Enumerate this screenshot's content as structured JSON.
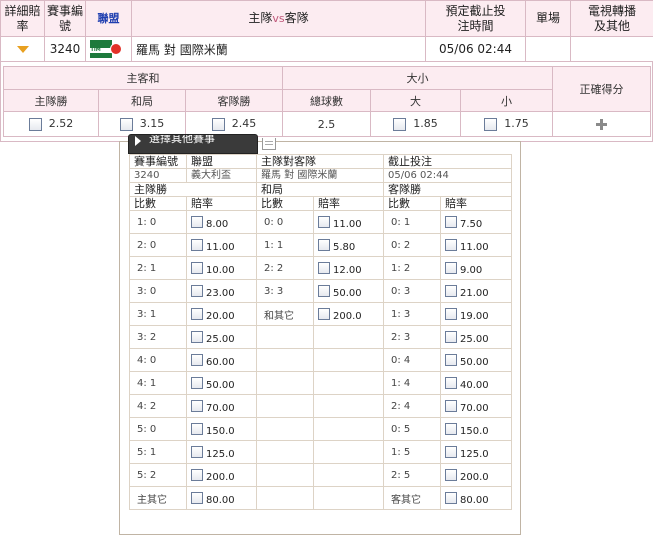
{
  "header": {
    "detail_odds": "詳細賠率",
    "match_no": "賽事編號",
    "league": "聯盟",
    "teams_prefix": "主隊",
    "teams_vs": "vs",
    "teams_suffix": "客隊",
    "close_time": "預定截止投注時間",
    "single": "單場",
    "tv": "電視轉播及其他"
  },
  "match": {
    "number": "3240",
    "league_icon": "tim-cup-logo",
    "home": "羅馬",
    "vs": "對",
    "away": "國際米蘭",
    "time": "05/06 02:44",
    "single": "",
    "tv": ""
  },
  "odds": {
    "group_hda": "主客和",
    "group_ou": "大小",
    "group_cs": "正確得分",
    "col_home": "主隊勝",
    "col_draw": "和局",
    "col_away": "客隊勝",
    "col_total": "總球數",
    "col_over": "大",
    "col_under": "小",
    "val_home": "2.52",
    "val_draw": "3.15",
    "val_away": "2.45",
    "val_total": "2.5",
    "val_over": "1.85",
    "val_under": "1.75",
    "expand_icon": "plus-icon"
  },
  "popup": {
    "tab_label": "選擇其他賽事",
    "head": {
      "match_no": "賽事編號",
      "league": "聯盟",
      "teams": "主隊對客隊",
      "close": "截止投注",
      "number": "3240",
      "league_name": "義大利盃",
      "teams_value": "羅馬 對 國際米蘭",
      "time": "05/06 02:44"
    },
    "sections": {
      "home": "主隊勝",
      "draw": "和局",
      "away": "客隊勝"
    },
    "col_score": "比數",
    "col_odds": "賠率",
    "home_scores": [
      {
        "s": "1: 0",
        "o": "8.00"
      },
      {
        "s": "2: 0",
        "o": "11.00"
      },
      {
        "s": "2: 1",
        "o": "10.00"
      },
      {
        "s": "3: 0",
        "o": "23.00"
      },
      {
        "s": "3: 1",
        "o": "20.00"
      },
      {
        "s": "3: 2",
        "o": "25.00"
      },
      {
        "s": "4: 0",
        "o": "60.00"
      },
      {
        "s": "4: 1",
        "o": "50.00"
      },
      {
        "s": "4: 2",
        "o": "70.00"
      },
      {
        "s": "5: 0",
        "o": "150.0"
      },
      {
        "s": "5: 1",
        "o": "125.0"
      },
      {
        "s": "5: 2",
        "o": "200.0"
      },
      {
        "s": "主其它",
        "o": "80.00"
      }
    ],
    "draw_scores": [
      {
        "s": "0: 0",
        "o": "11.00"
      },
      {
        "s": "1: 1",
        "o": "5.80"
      },
      {
        "s": "2: 2",
        "o": "12.00"
      },
      {
        "s": "3: 3",
        "o": "50.00"
      },
      {
        "s": "和其它",
        "o": "200.0"
      }
    ],
    "away_scores": [
      {
        "s": "0: 1",
        "o": "7.50"
      },
      {
        "s": "0: 2",
        "o": "11.00"
      },
      {
        "s": "1: 2",
        "o": "9.00"
      },
      {
        "s": "0: 3",
        "o": "21.00"
      },
      {
        "s": "1: 3",
        "o": "19.00"
      },
      {
        "s": "2: 3",
        "o": "25.00"
      },
      {
        "s": "0: 4",
        "o": "50.00"
      },
      {
        "s": "1: 4",
        "o": "40.00"
      },
      {
        "s": "2: 4",
        "o": "70.00"
      },
      {
        "s": "0: 5",
        "o": "150.0"
      },
      {
        "s": "1: 5",
        "o": "125.0"
      },
      {
        "s": "2: 5",
        "o": "200.0"
      },
      {
        "s": "客其它",
        "o": "80.00"
      }
    ]
  },
  "colors": {
    "header_bg": "#fcecf1",
    "border": "#d9b9c4",
    "link_blue": "#1f3fb0",
    "vs_pink": "#c0587a",
    "popup_border": "#c0b4a4"
  }
}
